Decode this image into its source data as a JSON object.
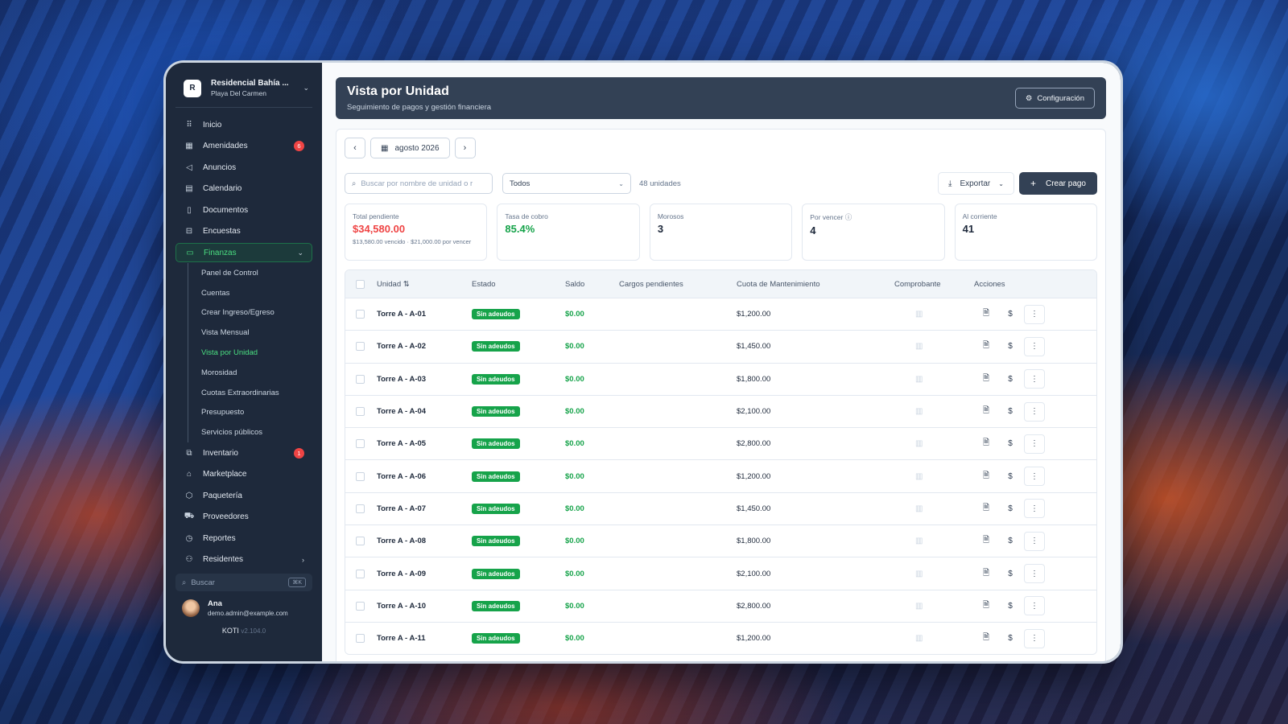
{
  "org": {
    "logo_letter": "R",
    "name": "Residencial Bahía ...",
    "city": "Playa Del Carmen"
  },
  "nav": [
    {
      "label": "Inicio",
      "icon": "grip-icon"
    },
    {
      "label": "Amenidades",
      "icon": "building-icon",
      "badge": "6"
    },
    {
      "label": "Anuncios",
      "icon": "megaphone-icon"
    },
    {
      "label": "Calendario",
      "icon": "calendar-icon"
    },
    {
      "label": "Documentos",
      "icon": "document-icon"
    },
    {
      "label": "Encuestas",
      "icon": "poll-icon"
    },
    {
      "label": "Finanzas",
      "icon": "wallet-icon"
    }
  ],
  "finanzas_sub": [
    "Panel de Control",
    "Cuentas",
    "Crear Ingreso/Egreso",
    "Vista Mensual",
    "Vista por Unidad",
    "Morosidad",
    "Cuotas Extraordinarias",
    "Presupuesto",
    "Servicios públicos"
  ],
  "nav2": [
    {
      "label": "Inventario",
      "icon": "boxes-icon",
      "badge": "1"
    },
    {
      "label": "Marketplace",
      "icon": "store-icon"
    },
    {
      "label": "Paquetería",
      "icon": "package-icon"
    },
    {
      "label": "Proveedores",
      "icon": "truck-icon"
    },
    {
      "label": "Reportes",
      "icon": "report-icon"
    },
    {
      "label": "Residentes",
      "icon": "users-icon"
    }
  ],
  "sidebar_search": {
    "placeholder": "Buscar",
    "shortcut": "⌘K"
  },
  "user": {
    "name": "Ana",
    "email": "demo.admin@example.com"
  },
  "app": {
    "name": "KOTI",
    "version": "v2.104.0"
  },
  "header": {
    "title": "Vista por Unidad",
    "subtitle": "Seguimiento de pagos y gestión financiera",
    "config_label": "Configuración"
  },
  "period": {
    "label": "agosto 2026"
  },
  "filters": {
    "search_placeholder": "Buscar por nombre de unidad o r",
    "select_value": "Todos",
    "units_count": "48 unidades",
    "export_label": "Exportar",
    "create_label": "Crear pago"
  },
  "stats": [
    {
      "label": "Total pendiente",
      "value": "$34,580.00",
      "note": "$13,580.00 vencido · $21,000.00 por vencer",
      "tone": "red"
    },
    {
      "label": "Tasa de cobro",
      "value": "85.4%",
      "tone": "green"
    },
    {
      "label": "Morosos",
      "value": "3"
    },
    {
      "label": "Por vencer",
      "value": "4",
      "info": true
    },
    {
      "label": "Al corriente",
      "value": "41"
    }
  ],
  "table": {
    "columns": [
      "Unidad",
      "Estado",
      "Saldo",
      "Cargos pendientes",
      "Cuota de Mantenimiento",
      "Comprobante",
      "Acciones"
    ],
    "rows": [
      {
        "unit": "Torre A - A-01",
        "status": "Sin adeudos",
        "saldo": "$0.00",
        "cargos": "",
        "cuota": "$1,200.00"
      },
      {
        "unit": "Torre A - A-02",
        "status": "Sin adeudos",
        "saldo": "$0.00",
        "cargos": "",
        "cuota": "$1,450.00"
      },
      {
        "unit": "Torre A - A-03",
        "status": "Sin adeudos",
        "saldo": "$0.00",
        "cargos": "",
        "cuota": "$1,800.00"
      },
      {
        "unit": "Torre A - A-04",
        "status": "Sin adeudos",
        "saldo": "$0.00",
        "cargos": "",
        "cuota": "$2,100.00"
      },
      {
        "unit": "Torre A - A-05",
        "status": "Sin adeudos",
        "saldo": "$0.00",
        "cargos": "",
        "cuota": "$2,800.00"
      },
      {
        "unit": "Torre A - A-06",
        "status": "Sin adeudos",
        "saldo": "$0.00",
        "cargos": "",
        "cuota": "$1,200.00"
      },
      {
        "unit": "Torre A - A-07",
        "status": "Sin adeudos",
        "saldo": "$0.00",
        "cargos": "",
        "cuota": "$1,450.00"
      },
      {
        "unit": "Torre A - A-08",
        "status": "Sin adeudos",
        "saldo": "$0.00",
        "cargos": "",
        "cuota": "$1,800.00"
      },
      {
        "unit": "Torre A - A-09",
        "status": "Sin adeudos",
        "saldo": "$0.00",
        "cargos": "",
        "cuota": "$2,100.00"
      },
      {
        "unit": "Torre A - A-10",
        "status": "Sin adeudos",
        "saldo": "$0.00",
        "cargos": "",
        "cuota": "$2,800.00"
      },
      {
        "unit": "Torre A - A-11",
        "status": "Sin adeudos",
        "saldo": "$0.00",
        "cargos": "",
        "cuota": "$1,200.00"
      }
    ]
  },
  "colors": {
    "accent": "#16a34a",
    "danger": "#ef4444",
    "sidebar": "#1e293b",
    "header": "#334155"
  }
}
